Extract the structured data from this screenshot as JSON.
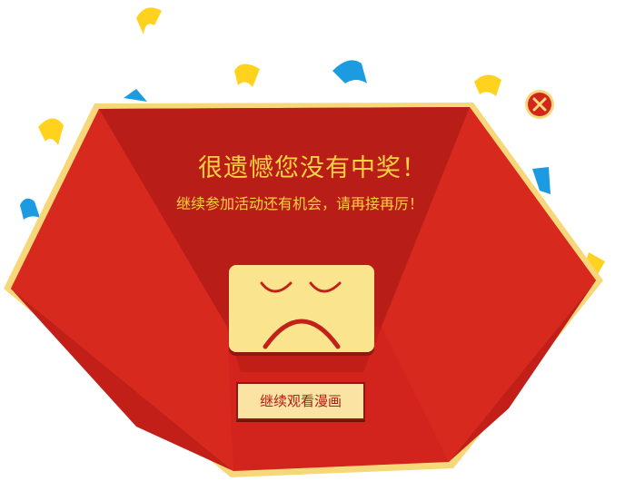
{
  "dialog": {
    "title": "很遗憾您没有中奖！",
    "subtitle": "继续参加活动还有机会，请再接再厉！",
    "cta_label": "继续观看漫画"
  },
  "icons": {
    "close": "close-icon",
    "sad_face": "sad-face-icon"
  },
  "colors": {
    "envelope_red": "#d3231d",
    "envelope_dark_red": "#b81d18",
    "border_yellow": "#f6d77a",
    "title_yellow": "#ffd23f",
    "card_yellow": "#fbe48e",
    "confetti_yellow": "#ffd21e",
    "confetti_blue": "#1d9be0",
    "close_red": "#d2261d"
  }
}
